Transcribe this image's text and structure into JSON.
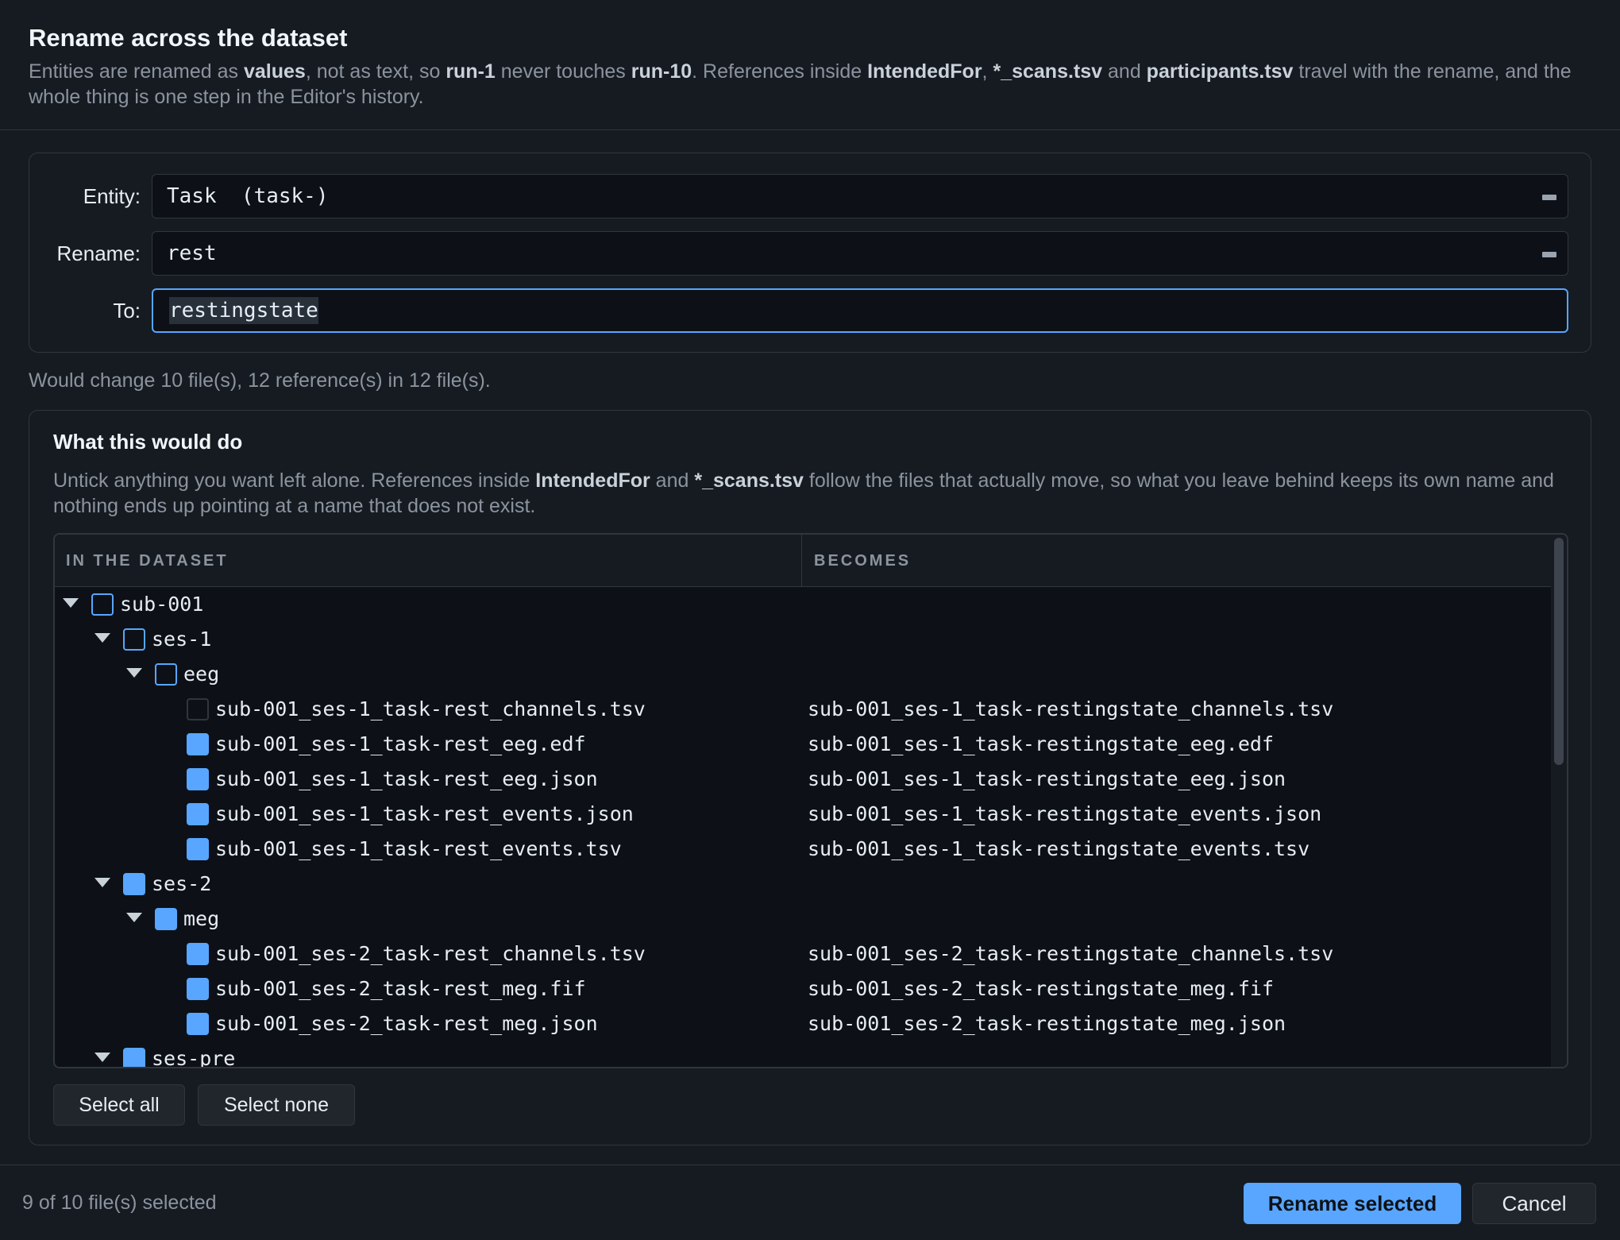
{
  "dialog": {
    "title": "Rename across the dataset",
    "subtitle": {
      "p1": "Entities are renamed as ",
      "b1": "values",
      "p2": ", not as text, so ",
      "b2": "run-1",
      "p3": " never touches ",
      "b3": "run-10",
      "p4": ". References inside ",
      "b4": "IntendedFor",
      "p5": ", ",
      "b5": "*_scans.tsv",
      "p6": " and ",
      "b6": "participants.tsv",
      "p7": " travel with the rename, and the whole thing is one step in the Editor's history."
    }
  },
  "form": {
    "entity_label": "Entity:",
    "entity_value": "Task  (task-)",
    "rename_label": "Rename:",
    "rename_value": "rest",
    "to_label": "To:",
    "to_value": "restingstate"
  },
  "summary": "Would change 10 file(s), 12 reference(s) in 12 file(s).",
  "preview": {
    "title": "What this would do",
    "desc": {
      "p1": "Untick anything you want left alone. References inside ",
      "b1": "IntendedFor",
      "p2": " and ",
      "b2": "*_scans.tsv",
      "p3": " follow the files that actually move, so what you leave behind keeps its own name and nothing ends up pointing at a name that does not exist."
    },
    "columns": [
      "IN THE DATASET",
      "BECOMES"
    ],
    "rows": [
      {
        "name": "sub-001",
        "becomes": "",
        "type": "folder",
        "checked": false
      },
      {
        "name": "ses-1",
        "becomes": "",
        "type": "folder",
        "checked": false
      },
      {
        "name": "eeg",
        "becomes": "",
        "type": "folder",
        "checked": false
      },
      {
        "name": "sub-001_ses-1_task-rest_channels.tsv",
        "becomes": "sub-001_ses-1_task-restingstate_channels.tsv",
        "type": "file",
        "checked": false
      },
      {
        "name": "sub-001_ses-1_task-rest_eeg.edf",
        "becomes": "sub-001_ses-1_task-restingstate_eeg.edf",
        "type": "file",
        "checked": true
      },
      {
        "name": "sub-001_ses-1_task-rest_eeg.json",
        "becomes": "sub-001_ses-1_task-restingstate_eeg.json",
        "type": "file",
        "checked": true
      },
      {
        "name": "sub-001_ses-1_task-rest_events.json",
        "becomes": "sub-001_ses-1_task-restingstate_events.json",
        "type": "file",
        "checked": true
      },
      {
        "name": "sub-001_ses-1_task-rest_events.tsv",
        "becomes": "sub-001_ses-1_task-restingstate_events.tsv",
        "type": "file",
        "checked": true
      },
      {
        "name": "ses-2",
        "becomes": "",
        "type": "folder",
        "checked": true
      },
      {
        "name": "meg",
        "becomes": "",
        "type": "folder",
        "checked": true
      },
      {
        "name": "sub-001_ses-2_task-rest_channels.tsv",
        "becomes": "sub-001_ses-2_task-restingstate_channels.tsv",
        "type": "file",
        "checked": true
      },
      {
        "name": "sub-001_ses-2_task-rest_meg.fif",
        "becomes": "sub-001_ses-2_task-restingstate_meg.fif",
        "type": "file",
        "checked": true
      },
      {
        "name": "sub-001_ses-2_task-rest_meg.json",
        "becomes": "sub-001_ses-2_task-restingstate_meg.json",
        "type": "file",
        "checked": true
      },
      {
        "name": "ses-pre",
        "becomes": "",
        "type": "folder",
        "checked": true
      }
    ],
    "select_all": "Select all",
    "select_none": "Select none"
  },
  "footer": {
    "status": "9 of 10 file(s) selected",
    "rename_button": "Rename selected",
    "cancel_button": "Cancel"
  },
  "colors": {
    "accent": "#58a6ff",
    "background": "#161b22",
    "table_background": "#0d1117"
  }
}
